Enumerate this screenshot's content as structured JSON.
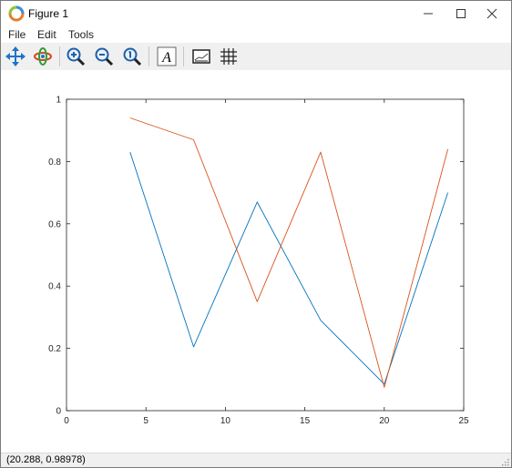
{
  "window": {
    "title": "Figure 1"
  },
  "menu": {
    "items": [
      "File",
      "Edit",
      "Tools"
    ]
  },
  "toolbar": {
    "tools": [
      "pan",
      "rotate",
      "zoom-in",
      "zoom-out",
      "zoom-reset",
      "text",
      "axes",
      "grid"
    ]
  },
  "status": {
    "coordinates": "(20.288, 0.98978)"
  },
  "chart_data": {
    "type": "line",
    "xlim": [
      0,
      25
    ],
    "ylim": [
      0,
      1
    ],
    "xticks": [
      0,
      5,
      10,
      15,
      20,
      25
    ],
    "yticks": [
      0,
      0.2,
      0.4,
      0.6,
      0.8,
      1
    ],
    "xtick_labels": [
      "0",
      "5",
      "10",
      "15",
      "20",
      "25"
    ],
    "ytick_labels": [
      "0",
      "0.2",
      "0.4",
      "0.6",
      "0.8",
      "1"
    ],
    "grid": false,
    "x": [
      4,
      8,
      12,
      16,
      20,
      24
    ],
    "series": [
      {
        "values": [
          0.83,
          0.205,
          0.67,
          0.29,
          0.085,
          0.7
        ],
        "color": "#0072bd"
      },
      {
        "values": [
          0.94,
          0.87,
          0.35,
          0.83,
          0.075,
          0.84
        ],
        "color": "#d95319"
      }
    ]
  }
}
